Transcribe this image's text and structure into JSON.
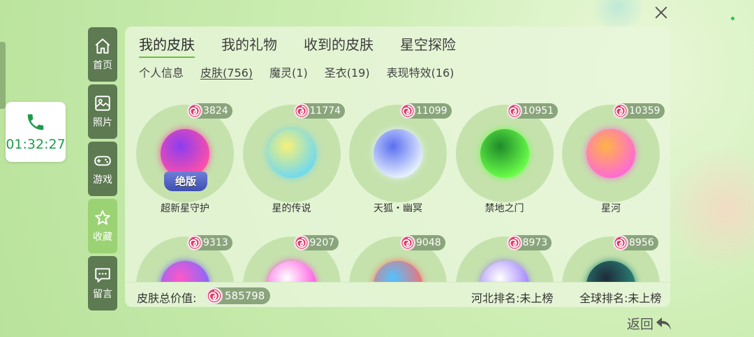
{
  "call": {
    "time": "01:32:27"
  },
  "sidebar": {
    "items": [
      {
        "label": "首页",
        "icon": "home-icon"
      },
      {
        "label": "照片",
        "icon": "photo-icon"
      },
      {
        "label": "游戏",
        "icon": "gamepad-icon"
      },
      {
        "label": "收藏",
        "icon": "star-icon",
        "active": true
      },
      {
        "label": "留言",
        "icon": "message-icon"
      }
    ]
  },
  "tabs": [
    "我的皮肤",
    "我的礼物",
    "收到的皮肤",
    "星空探险"
  ],
  "active_tab": "我的皮肤",
  "subtabs": [
    "个人信息",
    "皮肤(756)",
    "魔灵(1)",
    "圣衣(19)",
    "表现特效(16)"
  ],
  "active_subtab": "皮肤(756)",
  "skins": [
    {
      "name": "超新星守护",
      "value": "3824",
      "tag": "绝版",
      "colors": [
        "#ff4fa8",
        "#8b3df0"
      ]
    },
    {
      "name": "星的传说",
      "value": "11774",
      "colors": [
        "#6fd9f0",
        "#f7f07a"
      ]
    },
    {
      "name": "天狐・幽冥",
      "value": "11099",
      "colors": [
        "#e8f1ff",
        "#5a6ff0"
      ]
    },
    {
      "name": "禁地之门",
      "value": "10951",
      "colors": [
        "#6bff4a",
        "#1f8a2a"
      ]
    },
    {
      "name": "星河",
      "value": "10359",
      "colors": [
        "#ff6ad5",
        "#ffb347"
      ]
    },
    {
      "name": "",
      "value": "9313",
      "colors": [
        "#7b6bff",
        "#ff57c8"
      ]
    },
    {
      "name": "",
      "value": "9207",
      "colors": [
        "#ff4fe0",
        "#ffffff"
      ]
    },
    {
      "name": "",
      "value": "9048",
      "colors": [
        "#ff6b6b",
        "#4fc3ff"
      ]
    },
    {
      "name": "",
      "value": "8973",
      "colors": [
        "#9b7bff",
        "#ffffff"
      ]
    },
    {
      "name": "",
      "value": "8956",
      "colors": [
        "#2b8a7a",
        "#1d2b3a"
      ]
    }
  ],
  "footer": {
    "total_label": "皮肤总价值:",
    "total_value": "585798",
    "rank_region": "河北排名:未上榜",
    "rank_global": "全球排名:未上榜"
  },
  "back_label": "返回"
}
